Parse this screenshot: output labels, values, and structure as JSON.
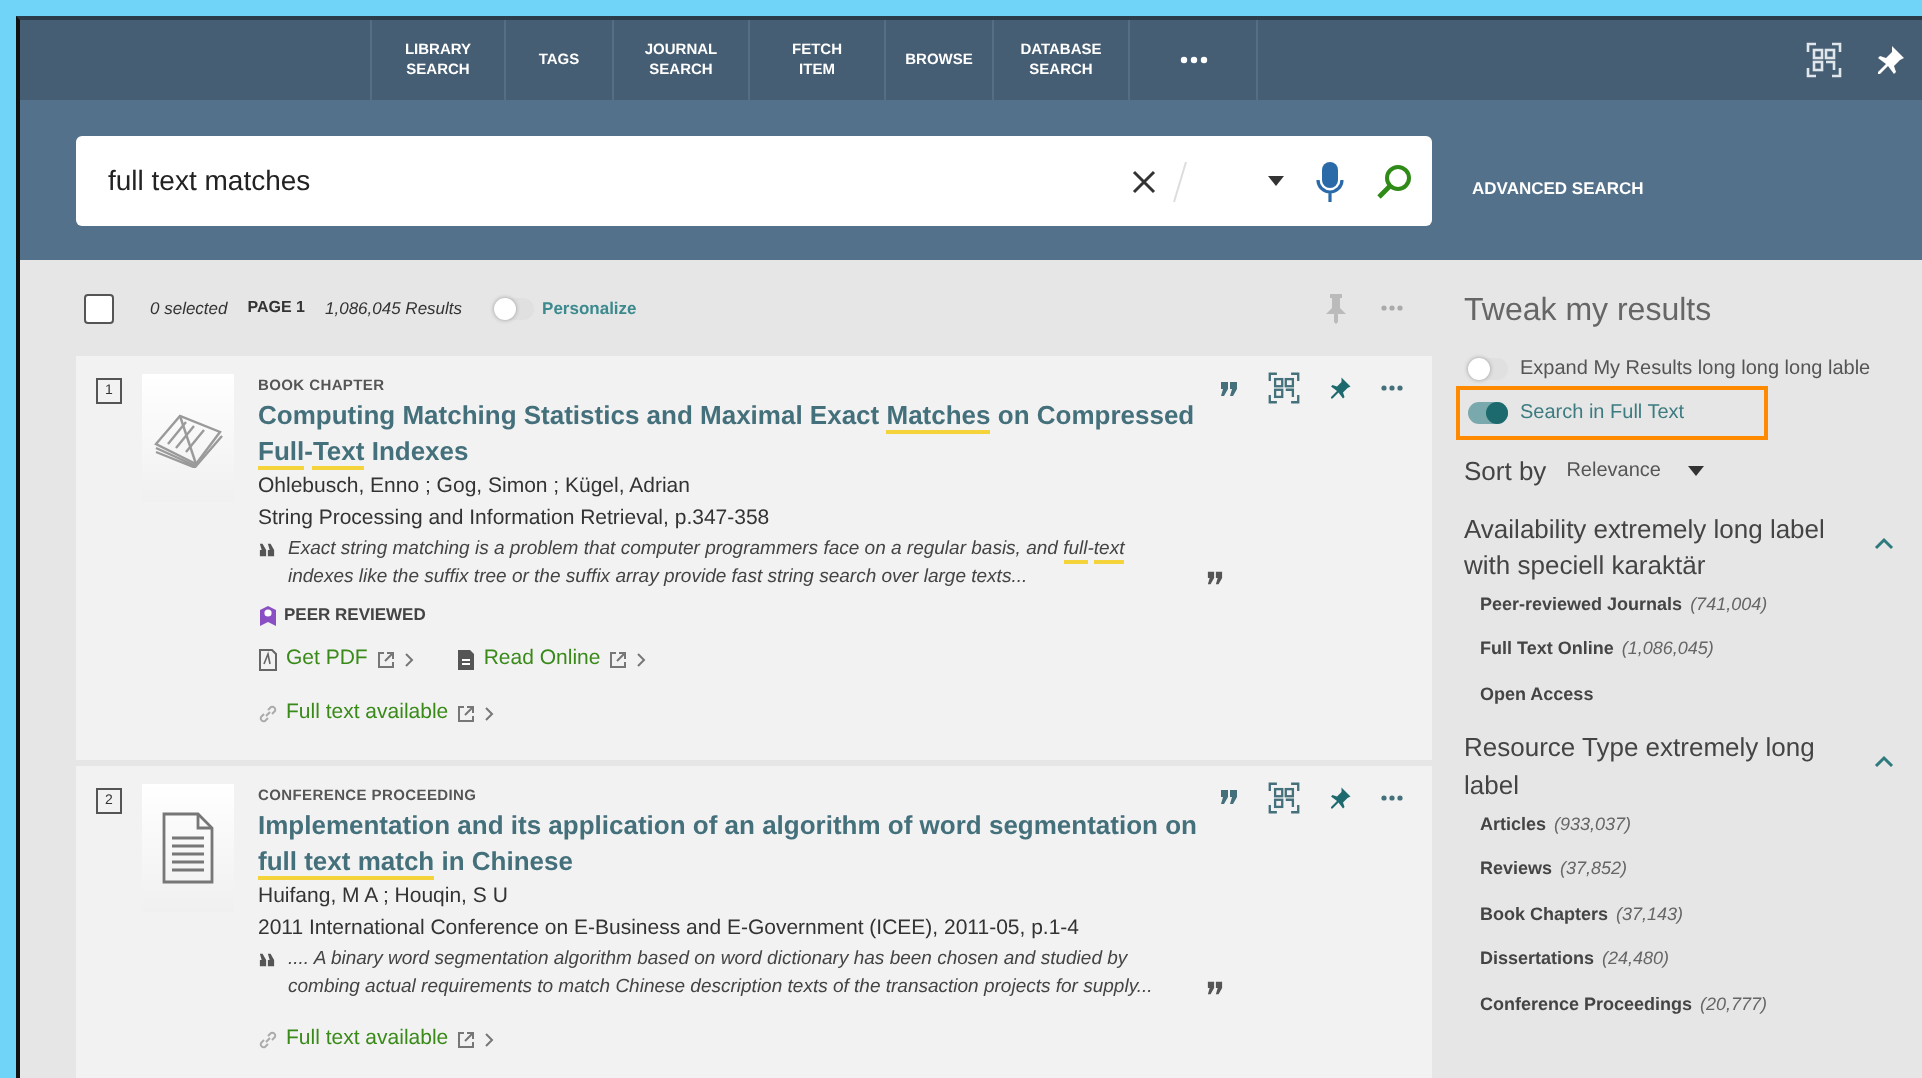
{
  "nav": {
    "items": [
      {
        "label": "LIBRARY SEARCH"
      },
      {
        "label": "TAGS"
      },
      {
        "label": "JOURNAL SEARCH"
      },
      {
        "label": "FETCH ITEM"
      },
      {
        "label": "BROWSE"
      },
      {
        "label": "DATABASE SEARCH"
      }
    ]
  },
  "search": {
    "value": "full text matches"
  },
  "advanced_search": "ADVANCED SEARCH",
  "toolbar": {
    "all_checked": false,
    "selected_count": "0 selected",
    "page": "PAGE 1",
    "results": "1,086,045 Results",
    "personalize": {
      "label": "Personalize",
      "on": false
    }
  },
  "results": [
    {
      "number": "1",
      "type": "BOOK CHAPTER",
      "kind": "book",
      "pinned": true,
      "title": [
        {
          "text": "Computing Matching Statistics and Maximal Exact ",
          "highlight": false
        },
        {
          "text": "Matches",
          "highlight": true
        },
        {
          "text": " on Compressed ",
          "highlight": false
        },
        {
          "text": "Full",
          "highlight": true
        },
        {
          "text": "-",
          "highlight": false
        },
        {
          "text": "Text",
          "highlight": true
        },
        {
          "text": " Indexes",
          "highlight": false
        }
      ],
      "authors": "Ohlebusch, Enno ; Gog, Simon ; Kügel, Adrian",
      "source": "String Processing and Information Retrieval, p.347-358",
      "snippet": [
        {
          "text": "Exact string matching is a problem that computer programmers face on a regular basis, and ",
          "highlight": false
        },
        {
          "text": "full",
          "highlight": true
        },
        {
          "text": "-",
          "highlight": false
        },
        {
          "text": "text",
          "highlight": true
        },
        {
          "text": " indexes like the suffix tree or the suffix array provide fast string search over large texts...",
          "highlight": false
        }
      ],
      "peer_reviewed": "PEER REVIEWED",
      "links": [
        {
          "kind": "pdf",
          "label": "Get PDF"
        },
        {
          "kind": "online",
          "label": "Read Online"
        }
      ],
      "availability": "Full text available"
    },
    {
      "number": "2",
      "type": "CONFERENCE PROCEEDING",
      "kind": "document",
      "pinned": true,
      "title": [
        {
          "text": "Implementation and its application of an algorithm of word segmentation on ",
          "highlight": false
        },
        {
          "text": "full text match",
          "highlight": true
        },
        {
          "text": " in Chinese",
          "highlight": false
        }
      ],
      "authors": "Huifang, M A ; Houqin, S U",
      "source": "2011 International Conference on E-Business and E-Government (ICEE), 2011-05, p.1-4",
      "snippet": [
        {
          "text": ".... A binary word segmentation algorithm based on word dictionary has been chosen and studied by combing actual requirements to match Chinese description texts of the transaction projects for supply...",
          "highlight": false
        }
      ],
      "availability": "Full text available"
    }
  ],
  "sidebar": {
    "title": "Tweak my results",
    "toggles": [
      {
        "label": "Expand My Results long long long lable",
        "on": false,
        "highlighted": false
      },
      {
        "label": "Search in Full Text",
        "on": true,
        "highlighted": true
      }
    ],
    "sort": {
      "label": "Sort by",
      "value": "Relevance"
    },
    "facets": [
      {
        "title": "Availability extremely long label with speciell karaktär",
        "expanded": true,
        "items": [
          {
            "label": "Peer-reviewed Journals",
            "count": "(741,004)"
          },
          {
            "label": "Full Text Online",
            "count": "(1,086,045)"
          },
          {
            "label": "Open Access"
          }
        ]
      },
      {
        "title": "Resource Type extremely long label",
        "expanded": true,
        "items": [
          {
            "label": "Articles",
            "count": "(933,037)"
          },
          {
            "label": "Reviews",
            "count": "(37,852)"
          },
          {
            "label": "Book Chapters",
            "count": "(37,143)"
          },
          {
            "label": "Dissertations",
            "count": "(24,480)"
          },
          {
            "label": "Conference Proceedings",
            "count": "(20,777)"
          }
        ]
      }
    ]
  }
}
